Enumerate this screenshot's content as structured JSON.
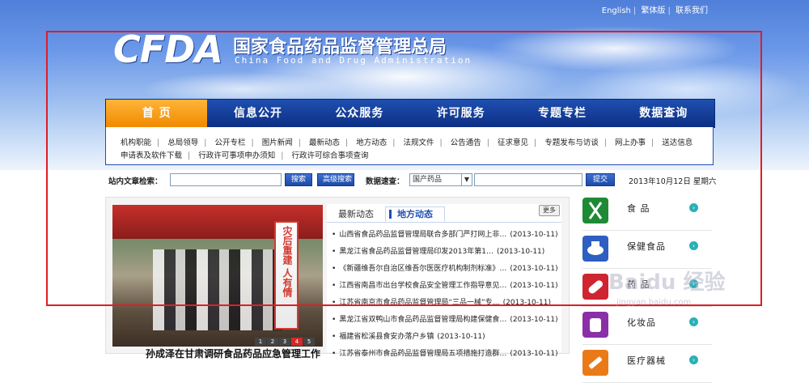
{
  "top_links": [
    "English",
    "繁体版",
    "联系我们"
  ],
  "logo": {
    "acronym": "CFDA",
    "name_cn": "国家食品药品监督管理总局",
    "name_en": "China Food and Drug Administration"
  },
  "nav": [
    "首 页",
    "信息公开",
    "公众服务",
    "许可服务",
    "专题专栏",
    "数据查询"
  ],
  "subnav_row1": [
    "机构职能",
    "总局领导",
    "公开专栏",
    "图片新闻",
    "最新动态",
    "地方动态",
    "法规文件",
    "公告通告",
    "征求意见",
    "专题发布与访谈",
    "网上办事",
    "送达信息"
  ],
  "subnav_row2": [
    "申请表及软件下载",
    "行政许可事项申办须知",
    "行政许可综合事项查询"
  ],
  "search": {
    "site_label": "站内文章检索：",
    "search_btn": "搜索",
    "advanced_btn": "高级搜索",
    "data_label": "数据速查：",
    "data_select": "国产药品",
    "submit_btn": "提交",
    "date": "2013年10月12日 星期六"
  },
  "photo": {
    "banner_text": "灾后重建 人有情",
    "tent_text": "",
    "pager": [
      "1",
      "2",
      "3",
      "4",
      "5"
    ],
    "current_page": "4",
    "caption": "孙成泽在甘肃调研食品药品应急管理工作"
  },
  "news": {
    "tab_latest": "最新动态",
    "tab_local": "地方动态",
    "more": "更多",
    "items": [
      {
        "title": "山西省食品药品监督管理局联合多部门严打网上非…",
        "date": "(2013-10-11)"
      },
      {
        "title": "黑龙江省食品药品监督管理局印发2013年第1…",
        "date": "(2013-10-11)"
      },
      {
        "title": "《新疆维吾尔自治区维吾尔医医疗机构制剂标准》…",
        "date": "(2013-10-11)"
      },
      {
        "title": "江西省南昌市出台学校食品安全管理工作指导意见…",
        "date": "(2013-10-11)"
      },
      {
        "title": "江苏省南京市食品药品监督管理局“三品一械”专…",
        "date": "(2013-10-11)"
      },
      {
        "title": "黑龙江省双鸭山市食品药品监督管理局构建保健食…",
        "date": "(2013-10-11)"
      },
      {
        "title": "福建省松溪县食安办落户乡镇",
        "date": "(2013-10-11)"
      },
      {
        "title": "江苏省泰州市食品药品监督管理局五项措施打造群…",
        "date": "(2013-10-11)"
      }
    ]
  },
  "categories": [
    {
      "name": "食 品",
      "icon": "fork-knife-icon",
      "color": "#1e8a35"
    },
    {
      "name": "保健食品",
      "icon": "health-food-icon",
      "color": "#2d5ec1"
    },
    {
      "name": "药 品",
      "icon": "pill-icon",
      "color": "#cf2530"
    },
    {
      "name": "化妆品",
      "icon": "cosmetics-icon",
      "color": "#8a2fa8"
    },
    {
      "name": "医疗器械",
      "icon": "syringe-icon",
      "color": "#ea7a18"
    }
  ],
  "watermark": {
    "text": "Baidu 经验",
    "sub": "jingyan.baidu.com"
  },
  "colors": {
    "nav_bg": "#1f4fb0",
    "nav_active": "#f08a00",
    "highlight_box": "#e01d25"
  }
}
